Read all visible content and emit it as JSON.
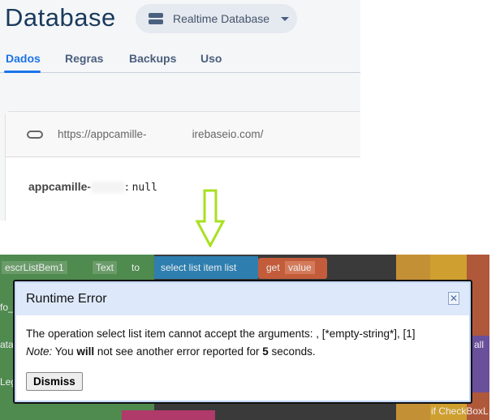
{
  "header": {
    "title": "Database",
    "db_selector": "Realtime Database"
  },
  "tabs": [
    {
      "label": "Dados"
    },
    {
      "label": "Regras"
    },
    {
      "label": "Backups"
    },
    {
      "label": "Uso"
    }
  ],
  "card": {
    "url_prefix": "https://appcamille-",
    "url_suffix": "irebaseio.com/",
    "root_key": "appcamille-",
    "root_value": "null"
  },
  "blocks": {
    "component": "escrListBem1",
    "property": "Text",
    "to": "to",
    "select": "select list item  list",
    "get": "get",
    "var": "value",
    "left1": "fo_",
    "left2": "ata",
    "left3": "Leg",
    "right1": "all",
    "bottom_right": "if CheckBoxL"
  },
  "dialog": {
    "title": "Runtime Error",
    "message": "The operation select list item cannot accept the arguments: , [*empty-string*], [1]",
    "note_label": "Note:",
    "note_text_1": "You",
    "note_bold_1": "will",
    "note_text_2": "not see another error reported for",
    "note_bold_2": "5",
    "note_text_3": "seconds.",
    "dismiss": "Dismiss"
  }
}
